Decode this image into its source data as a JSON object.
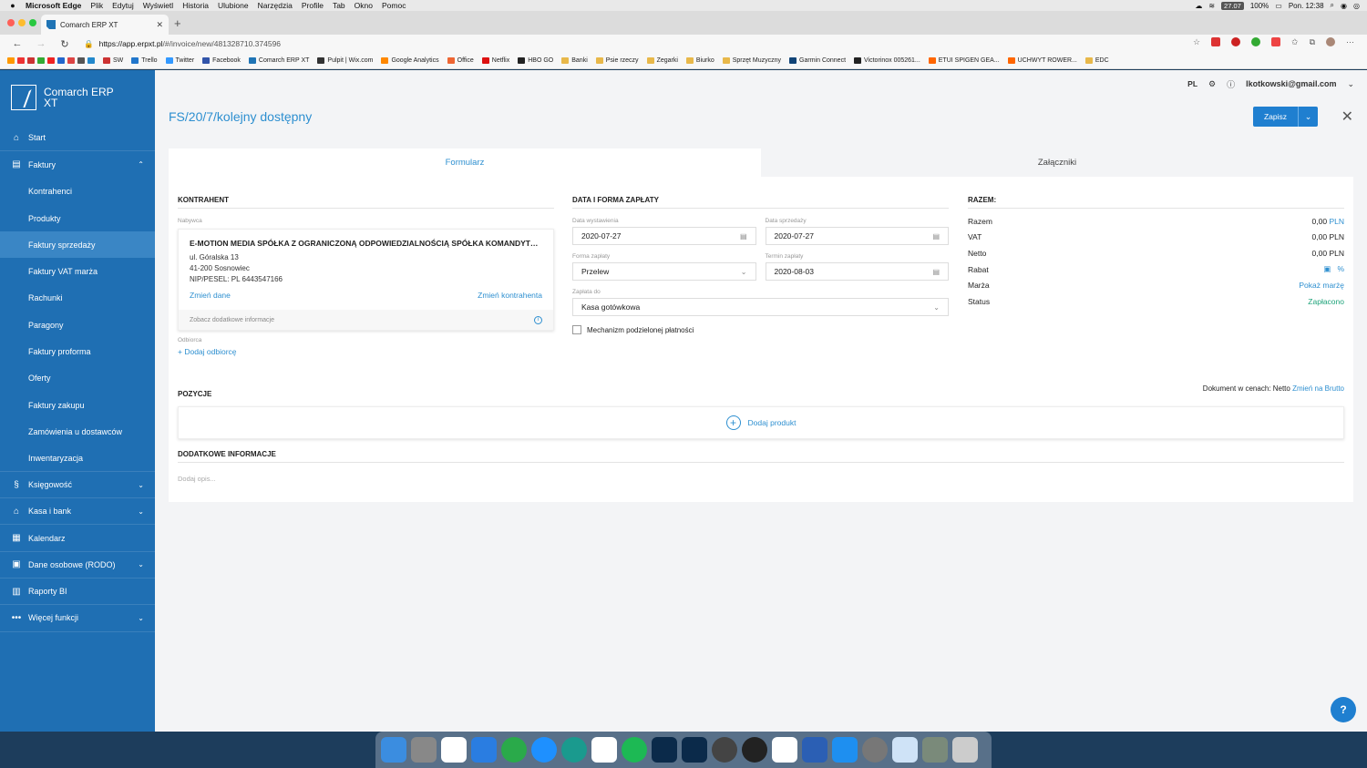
{
  "menubar": {
    "app": "Microsoft Edge",
    "items": [
      "Plik",
      "Edytuj",
      "Wyświetl",
      "Historia",
      "Ulubione",
      "Narzędzia",
      "Profile",
      "Tab",
      "Okno",
      "Pomoc"
    ],
    "battery_badge": "27.07",
    "battery": "100%",
    "clock": "Pon. 12:38"
  },
  "browser": {
    "tab_title": "Comarch ERP XT",
    "url_host": "https://app.erpxt.pl",
    "url_path": "/#/invoice/new/481328710.374596",
    "bookmarks": [
      "SW",
      "Trello",
      "Twitter",
      "Facebook",
      "Comarch ERP XT",
      "Pulpit | Wix.com",
      "Google Analytics",
      "Office",
      "Netflix",
      "HBO GO",
      "Banki",
      "Psie rzeczy",
      "Zegarki",
      "Biurko",
      "Sprzęt Muzyczny",
      "Garmin Connect",
      "Victorinox 005261...",
      "ETUI SPIGEN GEA...",
      "UCHWYT ROWER...",
      "EDC"
    ]
  },
  "sidebar": {
    "logo_line1": "Comarch ERP",
    "logo_line2": "XT",
    "items": [
      {
        "label": "Start",
        "icon": "home-icon"
      },
      {
        "label": "Faktury",
        "icon": "invoice-icon"
      },
      {
        "label": "Kontrahenci"
      },
      {
        "label": "Produkty"
      },
      {
        "label": "Faktury sprzedaży",
        "active": true
      },
      {
        "label": "Faktury VAT marża"
      },
      {
        "label": "Rachunki"
      },
      {
        "label": "Paragony"
      },
      {
        "label": "Faktury proforma"
      },
      {
        "label": "Oferty"
      },
      {
        "label": "Faktury zakupu"
      },
      {
        "label": "Zamówienia u dostawców"
      },
      {
        "label": "Inwentaryzacja"
      },
      {
        "label": "Księgowość",
        "icon": "accounting-icon"
      },
      {
        "label": "Kasa i bank",
        "icon": "bank-icon"
      },
      {
        "label": "Kalendarz",
        "icon": "calendar-icon"
      },
      {
        "label": "Dane osobowe (RODO)",
        "icon": "person-icon"
      },
      {
        "label": "Raporty BI",
        "icon": "chart-icon"
      },
      {
        "label": "Więcej funkcji",
        "icon": "more-icon"
      }
    ]
  },
  "topbar": {
    "lang": "PL",
    "email": "lkotkowski@gmail.com"
  },
  "header": {
    "title": "FS/20/7/kolejny dostępny",
    "save_label": "Zapisz"
  },
  "tabs": {
    "form": "Formularz",
    "attachments": "Załączniki"
  },
  "contractor": {
    "heading": "KONTRAHENT",
    "buyer_label": "Nabywca",
    "name": "E-MOTION MEDIA SPÓŁKA Z OGRANICZONĄ ODPOWIEDZIALNOŚCIĄ SPÓŁKA KOMANDYTO...",
    "street": "ul. Góralska 13",
    "city": "41-200 Sosnowiec",
    "nip": "NIP/PESEL: PL 6443547166",
    "change_data": "Zmień dane",
    "change_contractor": "Zmień kontrahenta",
    "more_info": "Zobacz dodatkowe informacje",
    "recipient_label": "Odbiorca",
    "add_recipient": "+ Dodaj odbiorcę"
  },
  "payment": {
    "heading": "DATA I FORMA ZAPŁATY",
    "issue_date_label": "Data wystawienia",
    "issue_date": "2020-07-27",
    "sale_date_label": "Data sprzedaży",
    "sale_date": "2020-07-27",
    "method_label": "Forma zapłaty",
    "method": "Przelew",
    "due_label": "Termin zapłaty",
    "due": "2020-08-03",
    "paid_to_label": "Zapłata do",
    "paid_to": "Kasa gotówkowa",
    "split_payment": "Mechanizm podzielonej płatności"
  },
  "totals": {
    "heading": "RAZEM:",
    "razem_label": "Razem",
    "razem_value": "0,00",
    "razem_cur": "PLN",
    "vat_label": "VAT",
    "vat_value": "0,00",
    "vat_cur": "PLN",
    "netto_label": "Netto",
    "netto_value": "0,00",
    "netto_cur": "PLN",
    "rabat_label": "Rabat",
    "rabat_unit": "%",
    "marza_label": "Marża",
    "marza_link": "Pokaż marżę",
    "status_label": "Status",
    "status_value": "Zapłacono"
  },
  "positions": {
    "heading": "POZYCJE",
    "prices_prefix": "Dokument w cenach: Netto",
    "switch_link": "Zmień na Brutto",
    "add_product": "Dodaj produkt"
  },
  "additional": {
    "heading": "DODATKOWE INFORMACJE",
    "placeholder": "Dodaj opis..."
  },
  "help": "?",
  "colors": {
    "sidebar": "#1f6fb3",
    "accent": "#2d8fd0",
    "status_green": "#1ea37a"
  }
}
